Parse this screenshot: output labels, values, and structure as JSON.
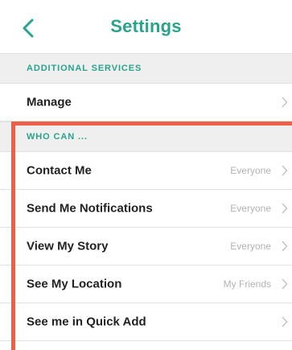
{
  "navbar": {
    "back_icon": "chevron-left-icon",
    "title": "Settings"
  },
  "sections": [
    {
      "header": "ADDITIONAL SERVICES",
      "rows": [
        {
          "label": "Manage",
          "value": ""
        }
      ]
    },
    {
      "header": "WHO CAN ...",
      "rows": [
        {
          "label": "Contact Me",
          "value": "Everyone"
        },
        {
          "label": "Send Me Notifications",
          "value": "Everyone"
        },
        {
          "label": "View My Story",
          "value": "Everyone"
        },
        {
          "label": "See My Location",
          "value": "My Friends"
        },
        {
          "label": "See me in Quick Add",
          "value": ""
        }
      ]
    }
  ],
  "colors": {
    "accent": "#2aa38c",
    "highlight": "#ec6049",
    "section_background": "#efefef",
    "secondary_text": "#b3b3b3"
  },
  "icons": {
    "row_disclosure": "chevron-right-icon"
  }
}
